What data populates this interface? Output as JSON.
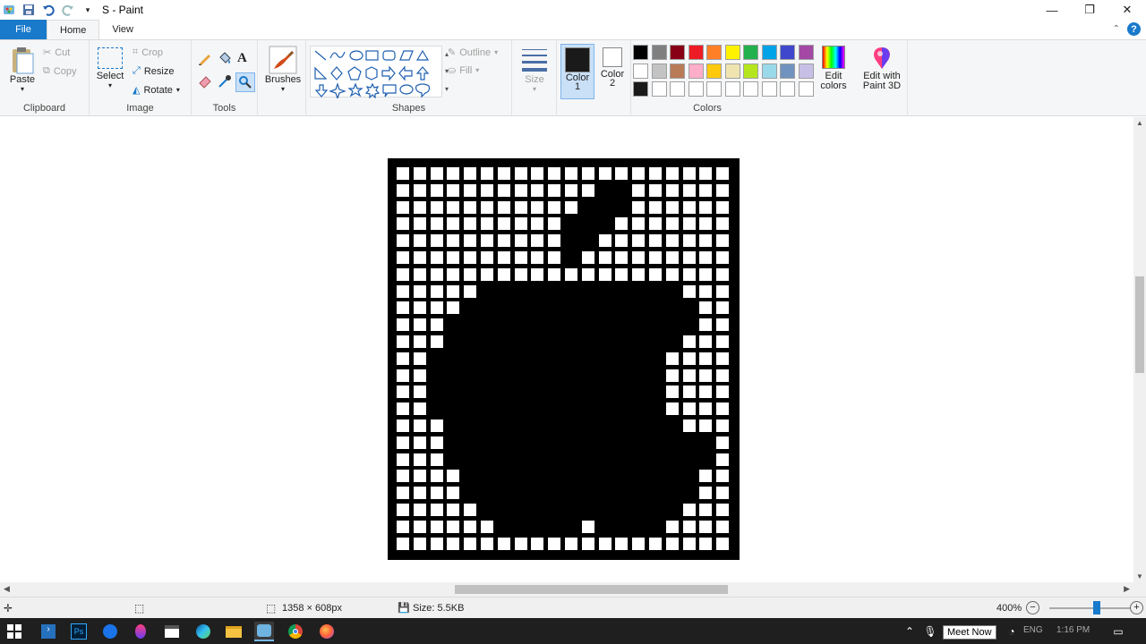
{
  "window": {
    "title": "S - Paint"
  },
  "tabs": [
    {
      "label": "File",
      "key": "file"
    },
    {
      "label": "Home",
      "key": "home"
    },
    {
      "label": "View",
      "key": "view"
    }
  ],
  "ribbon": {
    "clipboard": {
      "label": "Clipboard",
      "paste": "Paste",
      "cut": "Cut",
      "copy": "Copy"
    },
    "image": {
      "label": "Image",
      "select": "Select",
      "crop": "Crop",
      "resize": "Resize",
      "rotate": "Rotate"
    },
    "tools": {
      "label": "Tools"
    },
    "brushes": {
      "label": "Brushes"
    },
    "shapes": {
      "label": "Shapes",
      "outline": "Outline",
      "fill": "Fill"
    },
    "size": {
      "label": "Size"
    },
    "color1": {
      "label": "Color",
      "num": "1",
      "value": "#1a1a1a"
    },
    "color2": {
      "label": "Color",
      "num": "2",
      "value": "#ffffff"
    },
    "colors": {
      "label": "Colors",
      "row1": [
        "#000000",
        "#7f7f7f",
        "#880015",
        "#ed1c24",
        "#ff7f27",
        "#fff200",
        "#22b14c",
        "#00a2e8",
        "#3f48cc",
        "#a349a4"
      ],
      "row2": [
        "#ffffff",
        "#c3c3c3",
        "#b97a57",
        "#ffaec9",
        "#ffc90e",
        "#efe4b0",
        "#b5e61d",
        "#99d9ea",
        "#7092be",
        "#c8bfe7"
      ],
      "row3": [
        "#1a1a1a",
        "#ffffff",
        "#ffffff",
        "#ffffff",
        "#ffffff",
        "#ffffff",
        "#ffffff",
        "#ffffff",
        "#ffffff",
        "#ffffff"
      ]
    },
    "edit_colors": {
      "line1": "Edit",
      "line2": "colors"
    },
    "paint3d": {
      "line1": "Edit with",
      "line2": "Paint 3D"
    }
  },
  "canvas": {
    "grid_cols": 20,
    "grid_rows": 23,
    "pattern": [
      "00000000000000000000",
      "00000000000011000000",
      "00000000000111000000",
      "00000000001110000000",
      "00000000001100000000",
      "00000000001000000000",
      "00000000000000000000",
      "00000111111111111000",
      "00001111111111111100",
      "00011111111111111100",
      "00011111111111111000",
      "00111111111111110000",
      "00111111111111110000",
      "00111111111111110000",
      "00111111111111110000",
      "00011111111111111000",
      "00011111111111111110",
      "00011111111111111110",
      "00001111111111111100",
      "00001111111111111100",
      "00000111111111111000",
      "00000011111011110000",
      "00000000000000000000"
    ]
  },
  "status": {
    "dimensions": "1358 × 608px",
    "size": "Size: 5.5KB",
    "zoom": "400%"
  },
  "taskbar": {
    "meet_now": "Meet Now",
    "lang": "ENG",
    "time": "1:16 PM"
  }
}
